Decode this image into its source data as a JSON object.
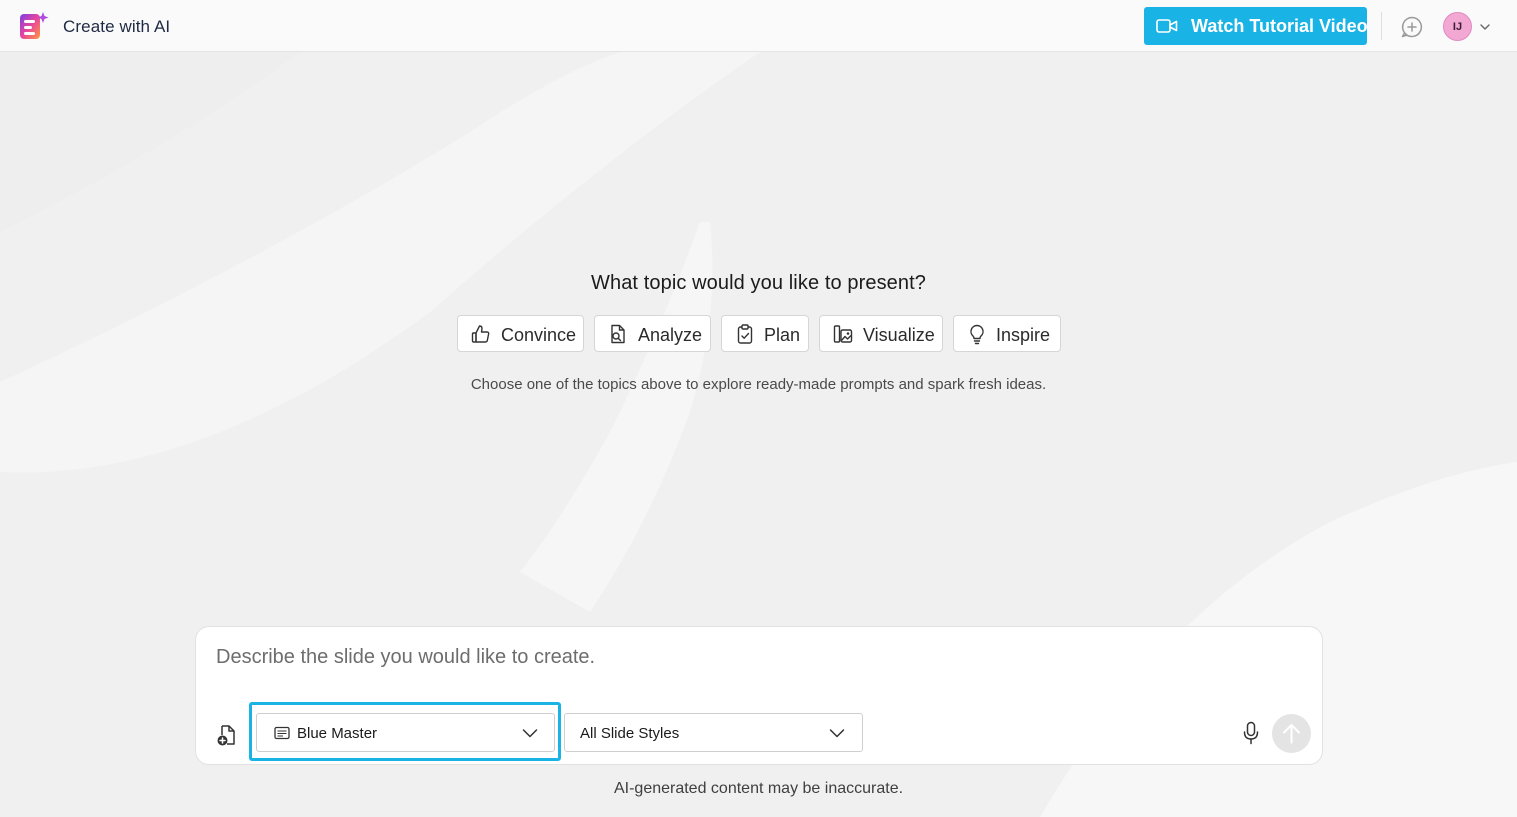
{
  "header": {
    "app_title": "Create with AI",
    "tutorial_label": "Watch Tutorial Video",
    "user_initials": "IJ"
  },
  "main": {
    "prompt_title": "What topic would you like to present?",
    "topics": [
      {
        "label": "Convince",
        "icon": "thumbs-up-icon"
      },
      {
        "label": "Analyze",
        "icon": "document-search-icon"
      },
      {
        "label": "Plan",
        "icon": "clipboard-check-icon"
      },
      {
        "label": "Visualize",
        "icon": "image-grid-icon"
      },
      {
        "label": "Inspire",
        "icon": "lightbulb-icon"
      }
    ],
    "hint": "Choose one of the topics above to explore ready-made prompts and spark fresh ideas."
  },
  "composer": {
    "placeholder": "Describe the slide you would like to create.",
    "value": "",
    "template_select": "Blue Master",
    "style_select": "All Slide Styles"
  },
  "footer": {
    "disclaimer": "AI-generated content may be inaccurate."
  },
  "colors": {
    "accent": "#1ab3e6",
    "background": "#f0f0f0",
    "avatar": "#f3a7d3"
  }
}
